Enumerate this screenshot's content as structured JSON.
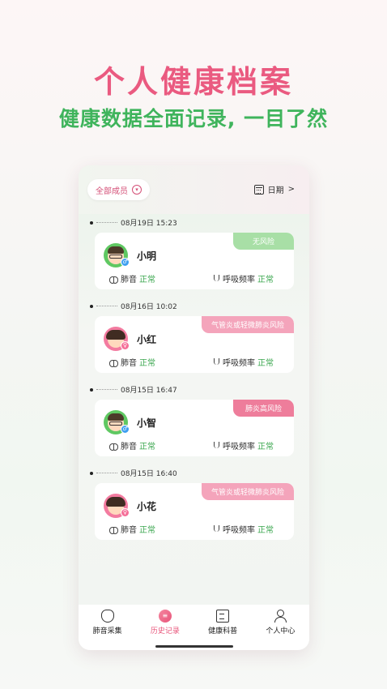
{
  "hero": {
    "title": "个人健康档案",
    "subtitle": "健康数据全面记录, 一目了然"
  },
  "filters": {
    "member": "全部成员",
    "date": "日期",
    "date_chevron": ">"
  },
  "records": [
    {
      "datetime": "08月19日 15:23",
      "name": "小明",
      "risk": "无风险",
      "gender": "♂",
      "lung_label": "肺音",
      "lung_status": "正常",
      "breath_label": "呼吸频率",
      "breath_status": "正常"
    },
    {
      "datetime": "08月16日 10:02",
      "name": "小红",
      "risk": "气管炎或轻微肺炎风险",
      "gender": "♀",
      "lung_label": "肺音",
      "lung_status": "正常",
      "breath_label": "呼吸频率",
      "breath_status": "正常"
    },
    {
      "datetime": "08月15日 16:47",
      "name": "小智",
      "risk": "肺炎高风险",
      "gender": "♂",
      "lung_label": "肺音",
      "lung_status": "正常",
      "breath_label": "呼吸频率",
      "breath_status": "正常"
    },
    {
      "datetime": "08月15日 16:40",
      "name": "小花",
      "risk": "气管炎或轻微肺炎风险",
      "gender": "♀",
      "lung_label": "肺音",
      "lung_status": "正常",
      "breath_label": "呼吸频率",
      "breath_status": "正常"
    }
  ],
  "tabs": [
    {
      "label": "肺音采集",
      "icon": "heartbeat-icon"
    },
    {
      "label": "历史记录",
      "icon": "history-icon"
    },
    {
      "label": "健康科普",
      "icon": "document-icon"
    },
    {
      "label": "个人中心",
      "icon": "user-icon"
    }
  ],
  "colors": {
    "brand_pink": "#ea5a80",
    "brand_green": "#3fb45c",
    "risk_none": "#a8dfa6",
    "risk_medium": "#f4a4bb",
    "risk_high": "#ee7d9b"
  }
}
